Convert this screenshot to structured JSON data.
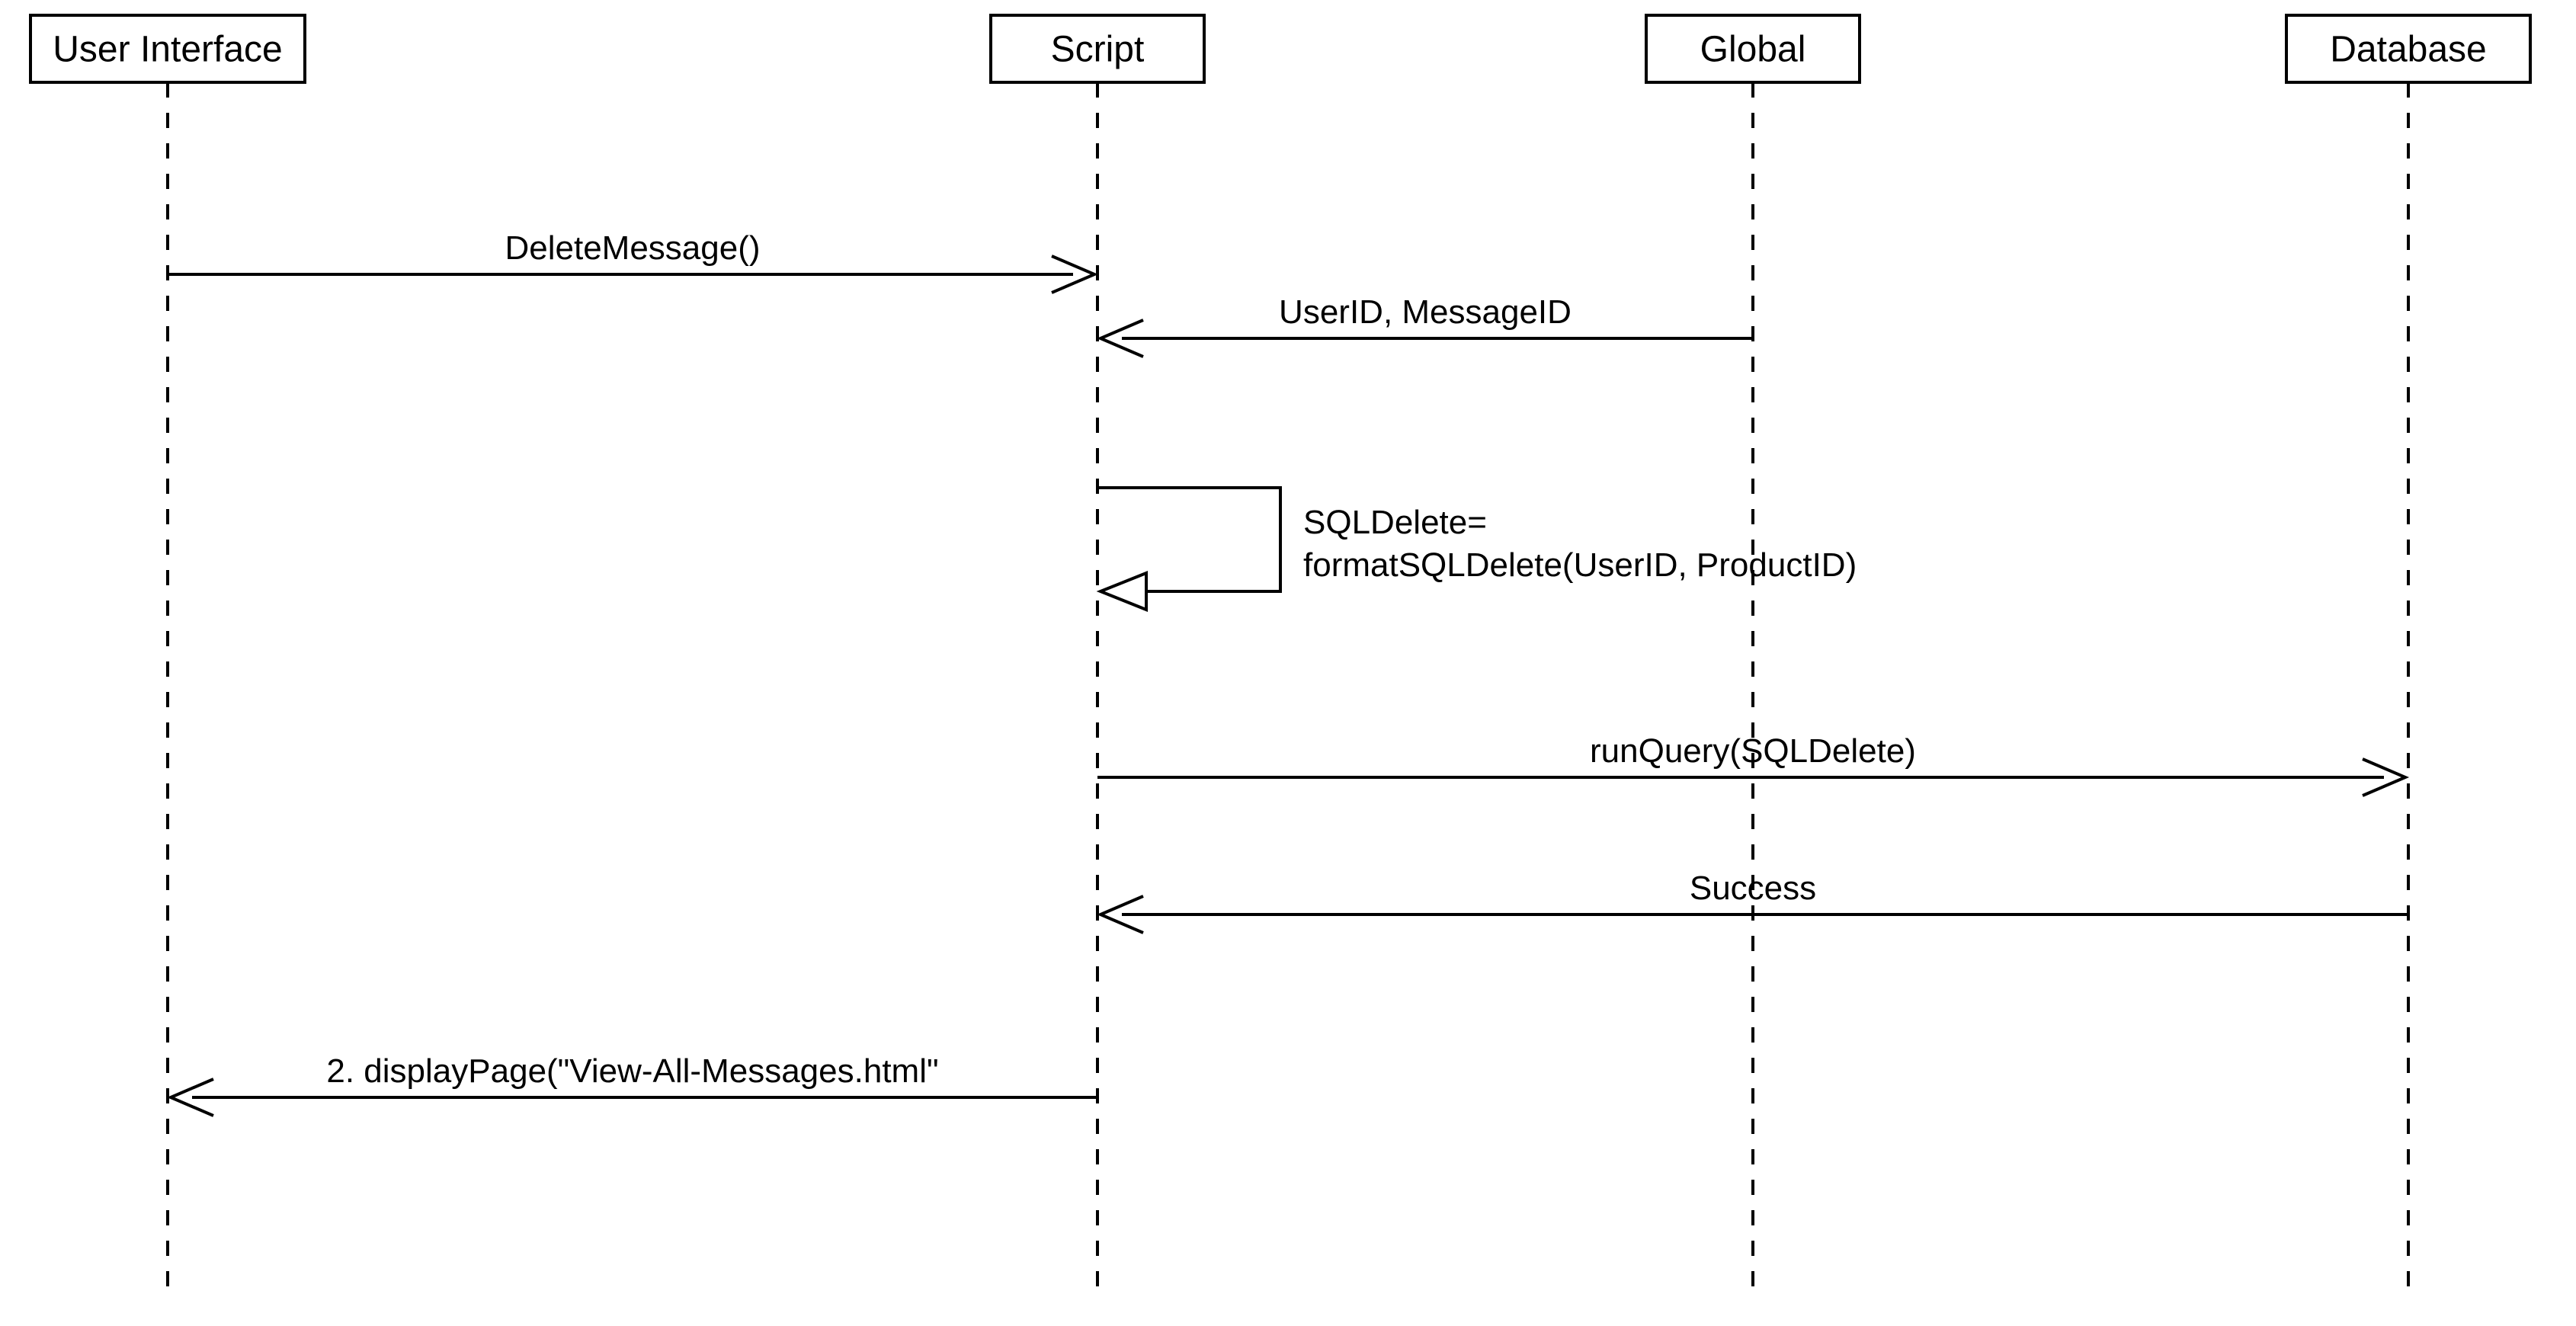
{
  "diagram": {
    "type": "uml-sequence-diagram",
    "lifelines": {
      "ui": {
        "label": "User Interface"
      },
      "script": {
        "label": "Script"
      },
      "global": {
        "label": "Global"
      },
      "database": {
        "label": "Database"
      }
    },
    "messages": {
      "m1": {
        "from": "ui",
        "to": "script",
        "label": "DeleteMessage()"
      },
      "m2": {
        "from": "global",
        "to": "script",
        "label": "UserID, MessageID"
      },
      "m3": {
        "from": "script",
        "to": "script",
        "label_line1": "SQLDelete=",
        "label_line2": "formatSQLDelete(UserID, ProductID)"
      },
      "m4": {
        "from": "script",
        "to": "database",
        "label": "runQuery(SQLDelete)"
      },
      "m5": {
        "from": "database",
        "to": "script",
        "label": "Success"
      },
      "m6": {
        "from": "script",
        "to": "ui",
        "label": "2. displayPage(\"View-All-Messages.html\""
      }
    }
  }
}
